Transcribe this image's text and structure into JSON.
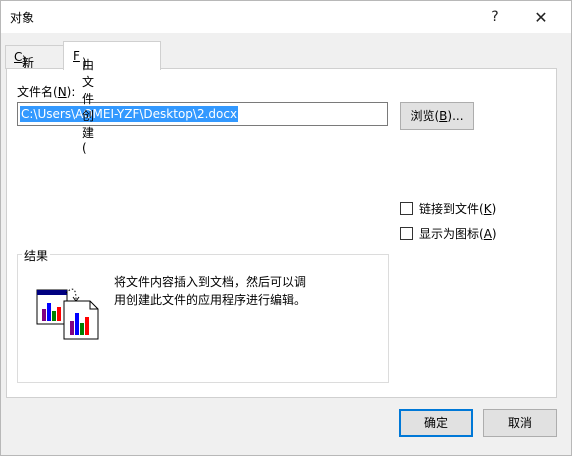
{
  "window": {
    "title": "对象",
    "help_label": "?",
    "close_label": "✕"
  },
  "tabs": [
    {
      "label_pre": "新建(",
      "mnemonic": "C",
      "label_post": ")",
      "active": false
    },
    {
      "label_pre": "由文件创建(",
      "mnemonic": "F",
      "label_post": ")",
      "active": true
    }
  ],
  "file": {
    "label_pre": "文件名(",
    "mnemonic": "N",
    "label_post": "):",
    "value": "C:\\Users\\AOMEI-YZF\\Desktop\\2.docx"
  },
  "browse": {
    "label_pre": "浏览(",
    "mnemonic": "B",
    "label_post": ")..."
  },
  "options": {
    "link": {
      "label_pre": "链接到文件(",
      "mnemonic": "K",
      "label_post": ")",
      "checked": false
    },
    "display_icon": {
      "label_pre": "显示为图标(",
      "mnemonic": "A",
      "label_post": ")",
      "checked": false
    }
  },
  "result": {
    "label": "结果",
    "line1": "将文件内容插入到文档，然后可以调",
    "line2": "用创建此文件的应用程序进行编辑。"
  },
  "buttons": {
    "ok": "确定",
    "cancel": "取消"
  },
  "colors": {
    "selection": "#3399ff",
    "default_border": "#0078d7"
  }
}
